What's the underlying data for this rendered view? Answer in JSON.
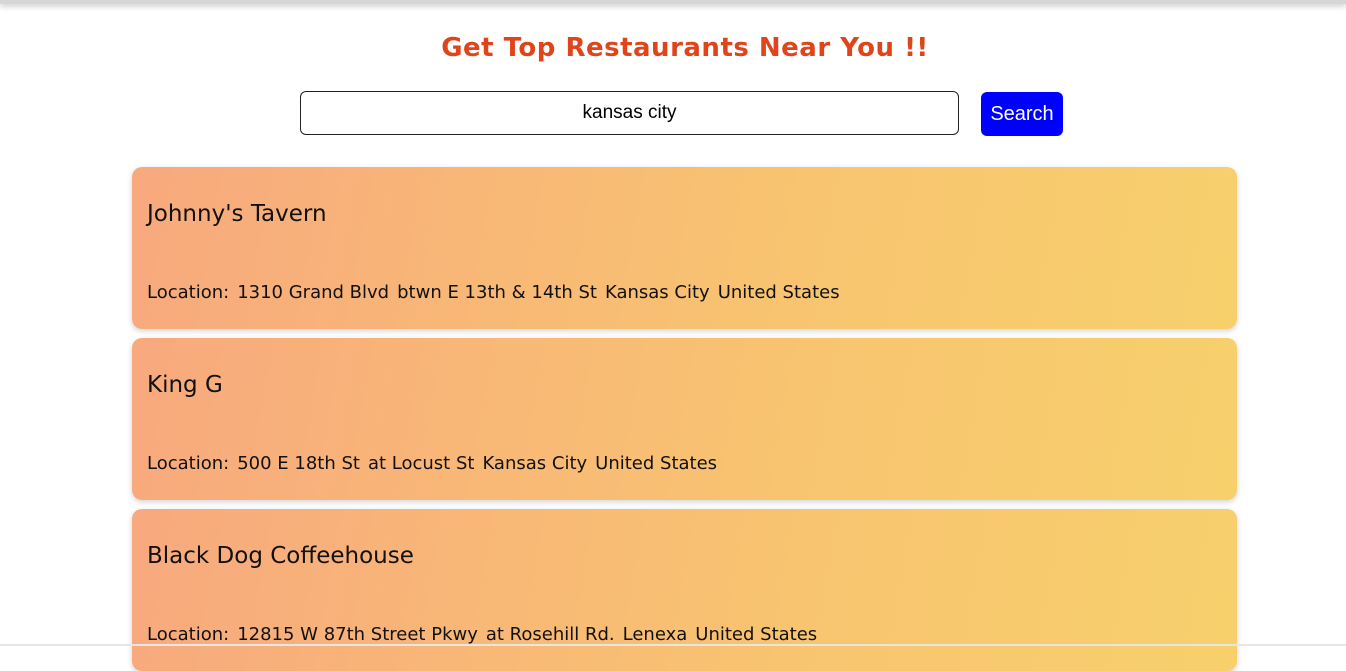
{
  "header": {
    "title": "Get Top Restaurants Near You !!"
  },
  "search": {
    "value": "kansas city",
    "button_label": "Search"
  },
  "restaurants": [
    {
      "name": "Johnny's Tavern",
      "location_label": "Location:",
      "address": "1310 Grand Blvd",
      "cross_street": "btwn E 13th & 14th St",
      "city": "Kansas City",
      "country": "United States"
    },
    {
      "name": "King G",
      "location_label": "Location:",
      "address": "500 E 18th St",
      "cross_street": "at Locust St",
      "city": "Kansas City",
      "country": "United States"
    },
    {
      "name": "Black Dog Coffeehouse",
      "location_label": "Location:",
      "address": "12815 W 87th Street Pkwy",
      "cross_street": "at Rosehill Rd.",
      "city": "Lenexa",
      "country": "United States"
    }
  ],
  "colors": {
    "title": "#e0441a",
    "button": "#0000ff",
    "card_gradient_start": "#f8a97e",
    "card_gradient_end": "#f7d06c"
  }
}
